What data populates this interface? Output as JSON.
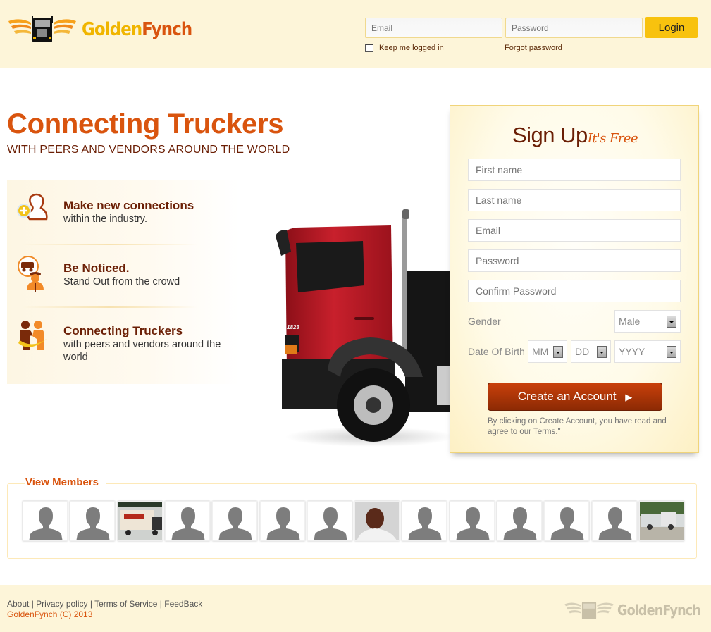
{
  "brand": {
    "name_part1": "Golden",
    "name_part2": "Fynch",
    "colors": {
      "gold": "#f0b500",
      "orange": "#d9540e",
      "brown": "#6b1f05",
      "cream": "#fdf5d9"
    }
  },
  "login": {
    "email_placeholder": "Email",
    "password_placeholder": "Password",
    "login_label": "Login",
    "keep_logged_in_label": "Keep me logged in",
    "keep_logged_in_checked": false,
    "forgot_password_label": "Forgot password"
  },
  "hero": {
    "title": "Connecting Truckers",
    "subtitle": "WITH PEERS AND VENDORS AROUND THE WORLD"
  },
  "features": [
    {
      "icon": "add-user-icon",
      "title": "Make new connections",
      "description": "within the industry."
    },
    {
      "icon": "driver-icon",
      "title": "Be Noticed.",
      "description": "Stand Out from the crowd"
    },
    {
      "icon": "handshake-icon",
      "title": "Connecting Truckers",
      "description": "with peers and vendors around the world"
    }
  ],
  "truck_image": {
    "label": "1823"
  },
  "signup": {
    "title": "Sign Up",
    "title_accent": "It's Free",
    "first_name_placeholder": "First name",
    "last_name_placeholder": "Last name",
    "email_placeholder": "Email",
    "password_placeholder": "Password",
    "confirm_password_placeholder": "Confirm Password",
    "gender_label": "Gender",
    "gender_value": "Male",
    "dob_label": "Date Of Birth",
    "dob_month": "MM",
    "dob_day": "DD",
    "dob_year": "YYYY",
    "create_button_label": "Create an Account",
    "create_button_icon": "play-arrow-icon",
    "terms_text": "By clicking on Create Account, you have read and agree to our Terms.\""
  },
  "members": {
    "title": "View Members",
    "items": [
      {
        "type": "placeholder"
      },
      {
        "type": "placeholder"
      },
      {
        "type": "photo",
        "subject": "box truck"
      },
      {
        "type": "placeholder"
      },
      {
        "type": "placeholder"
      },
      {
        "type": "placeholder"
      },
      {
        "type": "placeholder"
      },
      {
        "type": "photo",
        "subject": "man portrait"
      },
      {
        "type": "placeholder"
      },
      {
        "type": "placeholder"
      },
      {
        "type": "placeholder"
      },
      {
        "type": "placeholder"
      },
      {
        "type": "placeholder"
      },
      {
        "type": "photo",
        "subject": "semi truck"
      }
    ]
  },
  "footer": {
    "links": [
      "About",
      "Privacy policy",
      "Terms of Service",
      "FeedBack"
    ],
    "separator": " | ",
    "copyright": "GoldenFynch (C) 2013"
  }
}
